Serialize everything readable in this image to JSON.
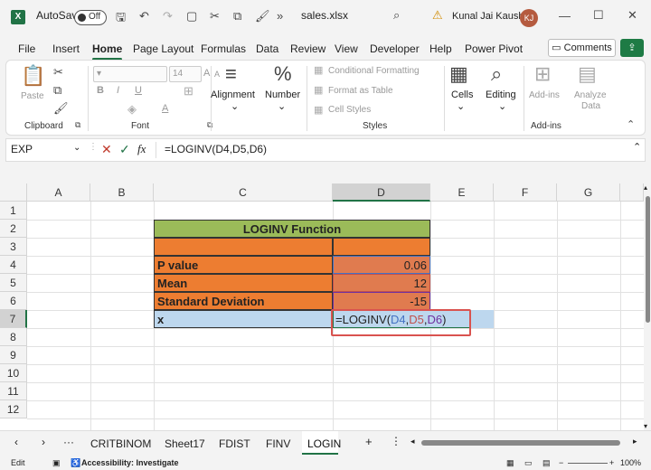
{
  "titlebar": {
    "autosave_label": "AutoSave",
    "autosave_state": "Off",
    "filename": "sales.xlsx",
    "user_name": "Kunal Jai Kaushik",
    "user_initials": "KJ",
    "app_badge": "X"
  },
  "tabs": [
    "File",
    "Insert",
    "Home",
    "Page Layout",
    "Formulas",
    "Data",
    "Review",
    "View",
    "Developer",
    "Help",
    "Power Pivot"
  ],
  "active_tab": "Home",
  "comments_label": "Comments",
  "ribbon": {
    "clipboard": {
      "paste": "Paste",
      "label": "Clipboard"
    },
    "font": {
      "size": "14",
      "bold": "B",
      "italic": "I",
      "underline": "U",
      "grow": "A",
      "shrink": "A",
      "color": "A",
      "label": "Font"
    },
    "alignment": "Alignment",
    "number": "Number",
    "number_glyph": "%",
    "styles": {
      "cond": "Conditional Formatting",
      "table": "Format as Table",
      "cell": "Cell Styles",
      "label": "Styles"
    },
    "cells": "Cells",
    "editing": "Editing",
    "addins": {
      "addins": "Add-ins",
      "analyze": "Analyze",
      "analyze_data": "Data",
      "label": "Add-ins"
    }
  },
  "formula_bar": {
    "name_box": "EXP",
    "fx": "fx",
    "formula": "=LOGINV(D4,D5,D6)"
  },
  "columns": [
    "A",
    "B",
    "C",
    "D",
    "E",
    "F",
    "G"
  ],
  "rows": [
    "1",
    "2",
    "3",
    "4",
    "5",
    "6",
    "7",
    "8",
    "9",
    "10",
    "11",
    "12"
  ],
  "table": {
    "title": "LOGINV Function",
    "labels": [
      "P value",
      "Mean",
      "Standard Deviation",
      "x"
    ],
    "values": [
      "0.06",
      "12",
      "-15"
    ],
    "edit": {
      "prefix": "=LOGINV(",
      "ref1": "D4",
      "ref2": "D5",
      "ref3": "D6",
      "suffix": ")",
      "comma": ","
    }
  },
  "colors": {
    "header_green": "#9bbb59",
    "orange": "#ed7d31",
    "value_orange": "#e07b4f",
    "x_blue": "#bdd7ee",
    "excel_green": "#217346",
    "ref_blue": "#4472c4",
    "ref_red": "#c0504d",
    "ref_purple": "#7030a0"
  },
  "sheet_tabs": [
    "CRITBINOM",
    "Sheet17",
    "FDIST",
    "FINV",
    "LOGIN"
  ],
  "status": {
    "mode": "Edit",
    "accessibility": "Accessibility: Investigate",
    "zoom": "100%"
  }
}
